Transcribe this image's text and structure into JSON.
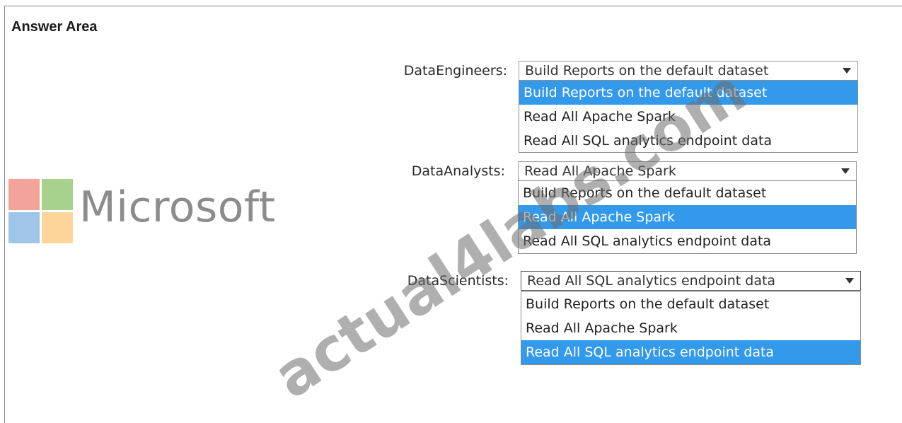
{
  "header": {
    "title": "Answer Area"
  },
  "logo": {
    "text": "Microsoft",
    "colors": [
      "#f4a39b",
      "#a6d28e",
      "#9fc5e9",
      "#fdd49a"
    ]
  },
  "watermark": {
    "text": "actual4labs.com"
  },
  "rows": [
    {
      "label": "DataEngineers:",
      "selected": "Build Reports on the default dataset",
      "options": [
        "Build Reports on the default dataset",
        "Read All Apache Spark",
        "Read All SQL analytics endpoint data"
      ],
      "highlighted_index": 0
    },
    {
      "label": "DataAnalysts:",
      "selected": "Read All Apache Spark",
      "options": [
        "Build Reports on the default dataset",
        "Read All Apache Spark",
        "Read All SQL analytics endpoint data"
      ],
      "highlighted_index": 1
    },
    {
      "label": "DataScientists:",
      "selected": "Read All SQL analytics endpoint data",
      "options": [
        "Build Reports on the default dataset",
        "Read All Apache Spark",
        "Read All SQL analytics endpoint data"
      ],
      "highlighted_index": 2
    }
  ],
  "colors": {
    "highlight": "#3399ea",
    "logo_text": "#8c8c8c"
  }
}
